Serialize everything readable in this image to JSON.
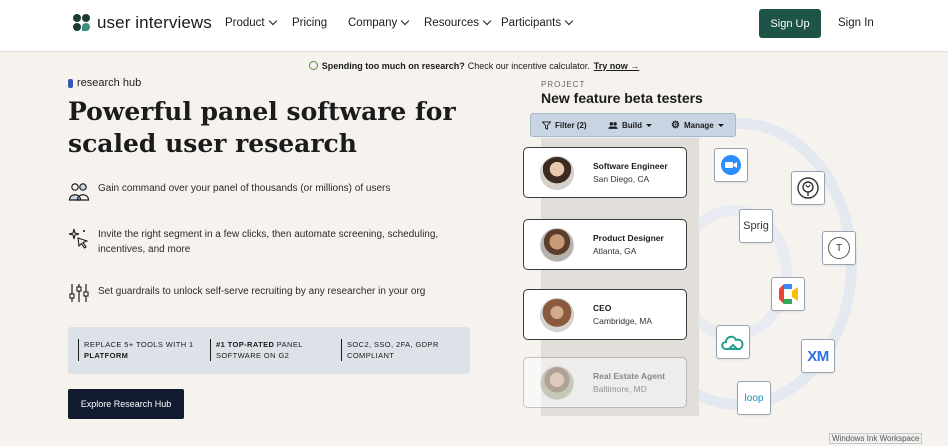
{
  "nav": {
    "logo_text": "user interviews",
    "items": [
      {
        "label": "Product"
      },
      {
        "label": "Pricing"
      },
      {
        "label": "Company"
      },
      {
        "label": "Resources"
      },
      {
        "label": "Participants"
      }
    ],
    "signup_label": "Sign Up",
    "signin_label": "Sign In",
    "accent_color": "#1e5448"
  },
  "banner": {
    "bold_text": "Spending too much on research?",
    "text": "Check our incentive calculator.",
    "link": "Try now →"
  },
  "hero": {
    "eyebrow": "research hub",
    "title": "Powerful panel software for scaled user research",
    "features": [
      {
        "icon": "users-icon",
        "text": "Gain command over your panel of thousands (or millions) of users"
      },
      {
        "icon": "sparkle-cursor-icon",
        "text": "Invite the right segment in a few clicks, then automate screening, scheduling, incentives, and more"
      },
      {
        "icon": "sliders-icon",
        "text": "Set guardrails to unlock self-serve recruiting by any researcher in your org"
      }
    ],
    "stats": [
      {
        "bold": "",
        "line1": "REPLACE 5+ TOOLS WITH 1",
        "line2": "PLATFORM"
      },
      {
        "bold": "#1 TOP-RATED",
        "line1": " PANEL",
        "line2": "SOFTWARE ON G2"
      },
      {
        "bold": "",
        "line1": "SOC2, SSO, 2FA, GDPR",
        "line2": "COMPLIANT"
      }
    ],
    "cta_label": "Explore Research Hub"
  },
  "project": {
    "label": "PROJECT",
    "title": "New feature beta testers",
    "toolbar": {
      "filter": "Filter (2)",
      "build": "Build",
      "manage": "Manage"
    },
    "participants": [
      {
        "role": "Software Engineer",
        "location": "San Diego, CA"
      },
      {
        "role": "Product Designer",
        "location": "Atlanta, GA"
      },
      {
        "role": "CEO",
        "location": "Cambridge, MA"
      },
      {
        "role": "Real Estate Agent",
        "location": "Baltimore, MD"
      }
    ],
    "integrations": [
      {
        "icon": "zoom-icon"
      },
      {
        "icon": "qualtrics-icon"
      },
      {
        "icon": "sprig-icon",
        "label": "Sprig"
      },
      {
        "icon": "typeform-icon",
        "label": "T"
      },
      {
        "icon": "google-meet-icon"
      },
      {
        "icon": "cloud-icon"
      },
      {
        "icon": "xm-icon",
        "label": "XM"
      },
      {
        "icon": "loop11-icon",
        "label": "loop"
      }
    ]
  },
  "system": {
    "watermark": "Windows Ink Workspace"
  }
}
